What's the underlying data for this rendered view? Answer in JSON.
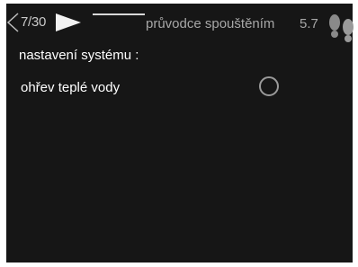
{
  "header": {
    "page_counter": "7/30",
    "title": "průvodce spouštěním",
    "code": "5.7"
  },
  "icons": {
    "prev": "chevron-left-icon",
    "next": "triangle-right-icon",
    "help": "footprints-icon"
  },
  "colors": {
    "background": "#161616",
    "text": "#ffffff",
    "header_text": "#a7a7a7",
    "radio_border": "#9a9a9a"
  },
  "content": {
    "section_label": "nastavení systému :",
    "options": [
      {
        "label": "ohřev teplé vody",
        "selected": false
      }
    ]
  }
}
